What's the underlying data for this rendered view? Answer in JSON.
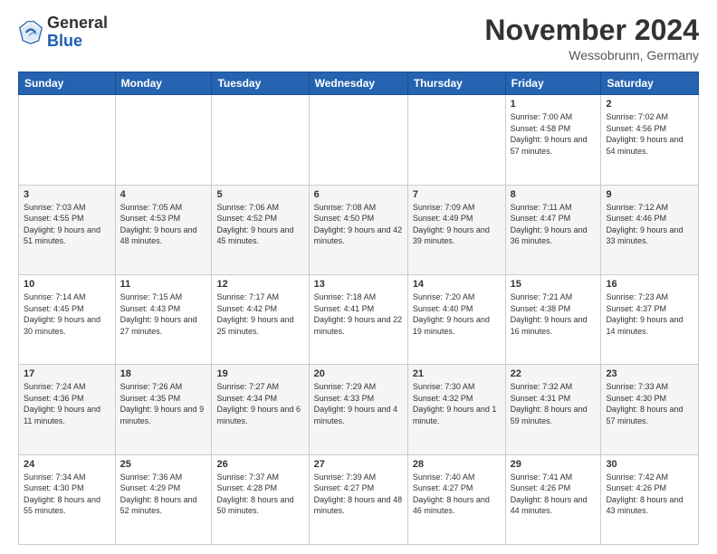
{
  "logo": {
    "text_general": "General",
    "text_blue": "Blue"
  },
  "header": {
    "month_title": "November 2024",
    "location": "Wessobrunn, Germany"
  },
  "days_of_week": [
    "Sunday",
    "Monday",
    "Tuesday",
    "Wednesday",
    "Thursday",
    "Friday",
    "Saturday"
  ],
  "weeks": [
    [
      {
        "num": "",
        "info": ""
      },
      {
        "num": "",
        "info": ""
      },
      {
        "num": "",
        "info": ""
      },
      {
        "num": "",
        "info": ""
      },
      {
        "num": "",
        "info": ""
      },
      {
        "num": "1",
        "info": "Sunrise: 7:00 AM\nSunset: 4:58 PM\nDaylight: 9 hours and 57 minutes."
      },
      {
        "num": "2",
        "info": "Sunrise: 7:02 AM\nSunset: 4:56 PM\nDaylight: 9 hours and 54 minutes."
      }
    ],
    [
      {
        "num": "3",
        "info": "Sunrise: 7:03 AM\nSunset: 4:55 PM\nDaylight: 9 hours and 51 minutes."
      },
      {
        "num": "4",
        "info": "Sunrise: 7:05 AM\nSunset: 4:53 PM\nDaylight: 9 hours and 48 minutes."
      },
      {
        "num": "5",
        "info": "Sunrise: 7:06 AM\nSunset: 4:52 PM\nDaylight: 9 hours and 45 minutes."
      },
      {
        "num": "6",
        "info": "Sunrise: 7:08 AM\nSunset: 4:50 PM\nDaylight: 9 hours and 42 minutes."
      },
      {
        "num": "7",
        "info": "Sunrise: 7:09 AM\nSunset: 4:49 PM\nDaylight: 9 hours and 39 minutes."
      },
      {
        "num": "8",
        "info": "Sunrise: 7:11 AM\nSunset: 4:47 PM\nDaylight: 9 hours and 36 minutes."
      },
      {
        "num": "9",
        "info": "Sunrise: 7:12 AM\nSunset: 4:46 PM\nDaylight: 9 hours and 33 minutes."
      }
    ],
    [
      {
        "num": "10",
        "info": "Sunrise: 7:14 AM\nSunset: 4:45 PM\nDaylight: 9 hours and 30 minutes."
      },
      {
        "num": "11",
        "info": "Sunrise: 7:15 AM\nSunset: 4:43 PM\nDaylight: 9 hours and 27 minutes."
      },
      {
        "num": "12",
        "info": "Sunrise: 7:17 AM\nSunset: 4:42 PM\nDaylight: 9 hours and 25 minutes."
      },
      {
        "num": "13",
        "info": "Sunrise: 7:18 AM\nSunset: 4:41 PM\nDaylight: 9 hours and 22 minutes."
      },
      {
        "num": "14",
        "info": "Sunrise: 7:20 AM\nSunset: 4:40 PM\nDaylight: 9 hours and 19 minutes."
      },
      {
        "num": "15",
        "info": "Sunrise: 7:21 AM\nSunset: 4:38 PM\nDaylight: 9 hours and 16 minutes."
      },
      {
        "num": "16",
        "info": "Sunrise: 7:23 AM\nSunset: 4:37 PM\nDaylight: 9 hours and 14 minutes."
      }
    ],
    [
      {
        "num": "17",
        "info": "Sunrise: 7:24 AM\nSunset: 4:36 PM\nDaylight: 9 hours and 11 minutes."
      },
      {
        "num": "18",
        "info": "Sunrise: 7:26 AM\nSunset: 4:35 PM\nDaylight: 9 hours and 9 minutes."
      },
      {
        "num": "19",
        "info": "Sunrise: 7:27 AM\nSunset: 4:34 PM\nDaylight: 9 hours and 6 minutes."
      },
      {
        "num": "20",
        "info": "Sunrise: 7:29 AM\nSunset: 4:33 PM\nDaylight: 9 hours and 4 minutes."
      },
      {
        "num": "21",
        "info": "Sunrise: 7:30 AM\nSunset: 4:32 PM\nDaylight: 9 hours and 1 minute."
      },
      {
        "num": "22",
        "info": "Sunrise: 7:32 AM\nSunset: 4:31 PM\nDaylight: 8 hours and 59 minutes."
      },
      {
        "num": "23",
        "info": "Sunrise: 7:33 AM\nSunset: 4:30 PM\nDaylight: 8 hours and 57 minutes."
      }
    ],
    [
      {
        "num": "24",
        "info": "Sunrise: 7:34 AM\nSunset: 4:30 PM\nDaylight: 8 hours and 55 minutes."
      },
      {
        "num": "25",
        "info": "Sunrise: 7:36 AM\nSunset: 4:29 PM\nDaylight: 8 hours and 52 minutes."
      },
      {
        "num": "26",
        "info": "Sunrise: 7:37 AM\nSunset: 4:28 PM\nDaylight: 8 hours and 50 minutes."
      },
      {
        "num": "27",
        "info": "Sunrise: 7:39 AM\nSunset: 4:27 PM\nDaylight: 8 hours and 48 minutes."
      },
      {
        "num": "28",
        "info": "Sunrise: 7:40 AM\nSunset: 4:27 PM\nDaylight: 8 hours and 46 minutes."
      },
      {
        "num": "29",
        "info": "Sunrise: 7:41 AM\nSunset: 4:26 PM\nDaylight: 8 hours and 44 minutes."
      },
      {
        "num": "30",
        "info": "Sunrise: 7:42 AM\nSunset: 4:26 PM\nDaylight: 8 hours and 43 minutes."
      }
    ]
  ]
}
